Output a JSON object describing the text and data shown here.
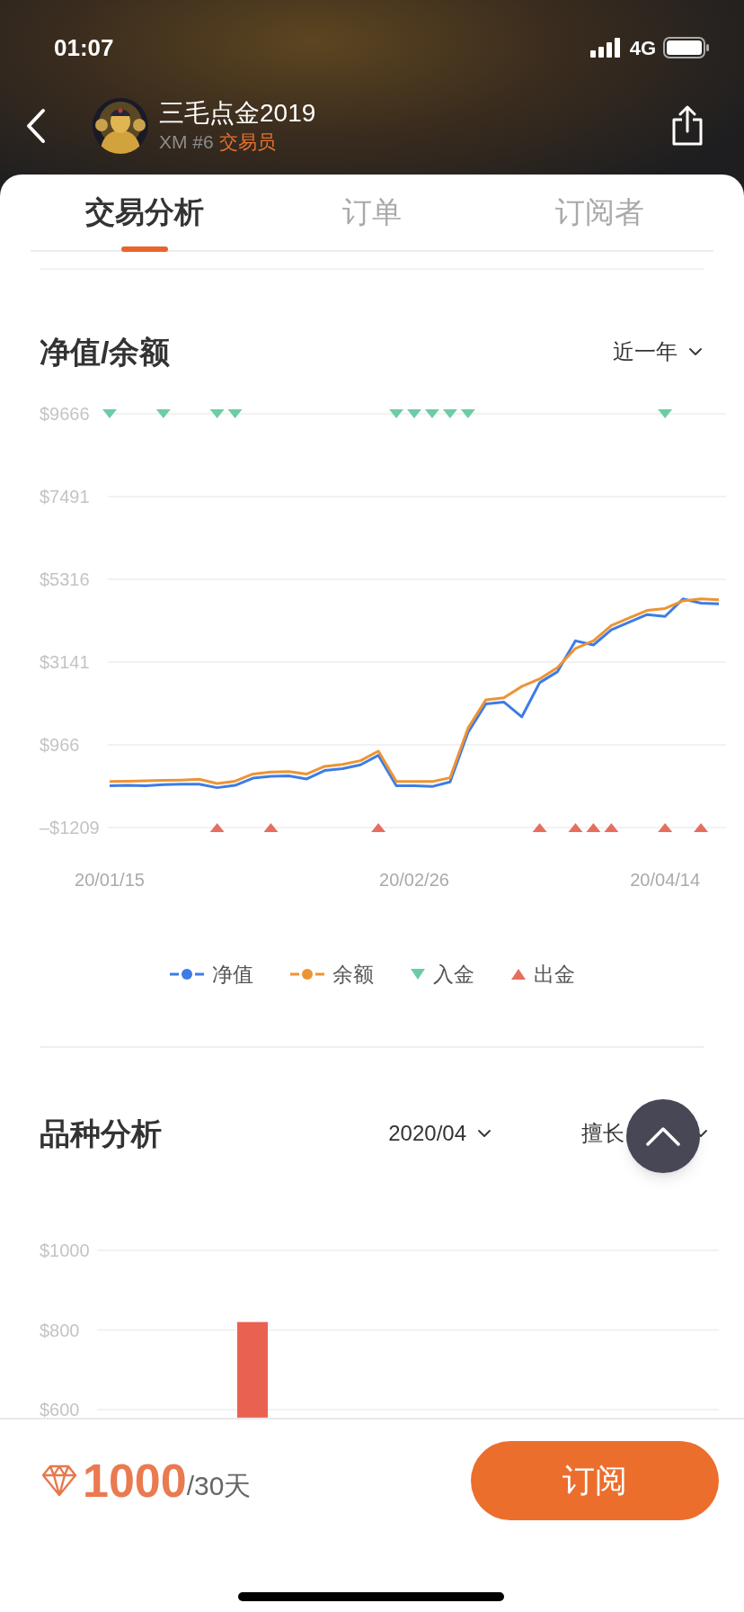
{
  "status_bar": {
    "time": "01:07",
    "network": "4G"
  },
  "header": {
    "name": "三毛点金2019",
    "broker": "XM #6",
    "role": "交易员"
  },
  "tabs": [
    {
      "label": "交易分析",
      "selected": true
    },
    {
      "label": "订单",
      "selected": false
    },
    {
      "label": "订阅者",
      "selected": false
    }
  ],
  "equity_section": {
    "title": "净值/余额",
    "range": "近一年",
    "chart_data": {
      "type": "line",
      "grid": true,
      "categories": [
        "20/01/15",
        null,
        null,
        null,
        null,
        null,
        null,
        null,
        null,
        null,
        null,
        null,
        null,
        null,
        null,
        null,
        null,
        "20/02/26",
        null,
        null,
        null,
        null,
        null,
        null,
        null,
        null,
        null,
        null,
        null,
        null,
        null,
        "20/04/14",
        null,
        null,
        null
      ],
      "ylim": [
        -1209,
        9666
      ],
      "yticks": [
        {
          "value": 9666,
          "label": "$9666"
        },
        {
          "value": 7491,
          "label": "$7491"
        },
        {
          "value": 5316,
          "label": "$5316"
        },
        {
          "value": 3141,
          "label": "$3141"
        },
        {
          "value": 966,
          "label": "$966"
        },
        {
          "value": -1209,
          "label": "–$1209"
        }
      ],
      "series": [
        {
          "name": "净值",
          "color": "#3d7ce6",
          "values": [
            -110,
            -100,
            -110,
            -80,
            -70,
            -70,
            -160,
            -100,
            90,
            140,
            150,
            70,
            290,
            340,
            440,
            690,
            -110,
            -110,
            -130,
            -10,
            1290,
            2040,
            2090,
            1700,
            2600,
            2890,
            3700,
            3590,
            3990,
            4190,
            4390,
            4340,
            4800,
            4690,
            4670
          ]
        },
        {
          "name": "余额",
          "color": "#ec9434",
          "values": [
            0,
            10,
            20,
            30,
            40,
            60,
            -50,
            10,
            200,
            250,
            260,
            200,
            400,
            450,
            550,
            800,
            0,
            0,
            0,
            100,
            1400,
            2150,
            2200,
            2500,
            2700,
            3000,
            3500,
            3700,
            4100,
            4300,
            4500,
            4550,
            4750,
            4800,
            4780
          ]
        },
        {
          "name": "入金",
          "color": "#6dcca6",
          "type": "scatter",
          "values": [
            9666,
            null,
            null,
            9666,
            null,
            null,
            9666,
            9666,
            null,
            null,
            null,
            null,
            null,
            null,
            null,
            null,
            9666,
            9666,
            9666,
            9666,
            9666,
            null,
            null,
            null,
            null,
            null,
            null,
            null,
            null,
            null,
            null,
            9666,
            null,
            null,
            null
          ]
        },
        {
          "name": "出金",
          "color": "#e66e5f",
          "type": "scatter",
          "values": [
            null,
            null,
            null,
            null,
            null,
            null,
            -1209,
            null,
            null,
            -1209,
            null,
            null,
            null,
            null,
            null,
            -1209,
            null,
            null,
            null,
            null,
            null,
            null,
            null,
            null,
            -1209,
            null,
            -1209,
            -1209,
            -1209,
            null,
            null,
            -1209,
            null,
            -1209,
            null
          ]
        }
      ]
    }
  },
  "symbol_section": {
    "title": "品种分析",
    "month": "2020/04",
    "filter": "擅长",
    "chart_data": {
      "type": "bar",
      "values": [
        null,
        820,
        null,
        null,
        null,
        null
      ],
      "ylim": [
        580,
        1000
      ],
      "yticks": [
        {
          "value": 1000,
          "label": "$1000"
        },
        {
          "value": 800,
          "label": "$800"
        },
        {
          "value": 600,
          "label": "$600"
        }
      ]
    }
  },
  "footer": {
    "price": "1000",
    "period": "/30天",
    "button": "订阅"
  }
}
